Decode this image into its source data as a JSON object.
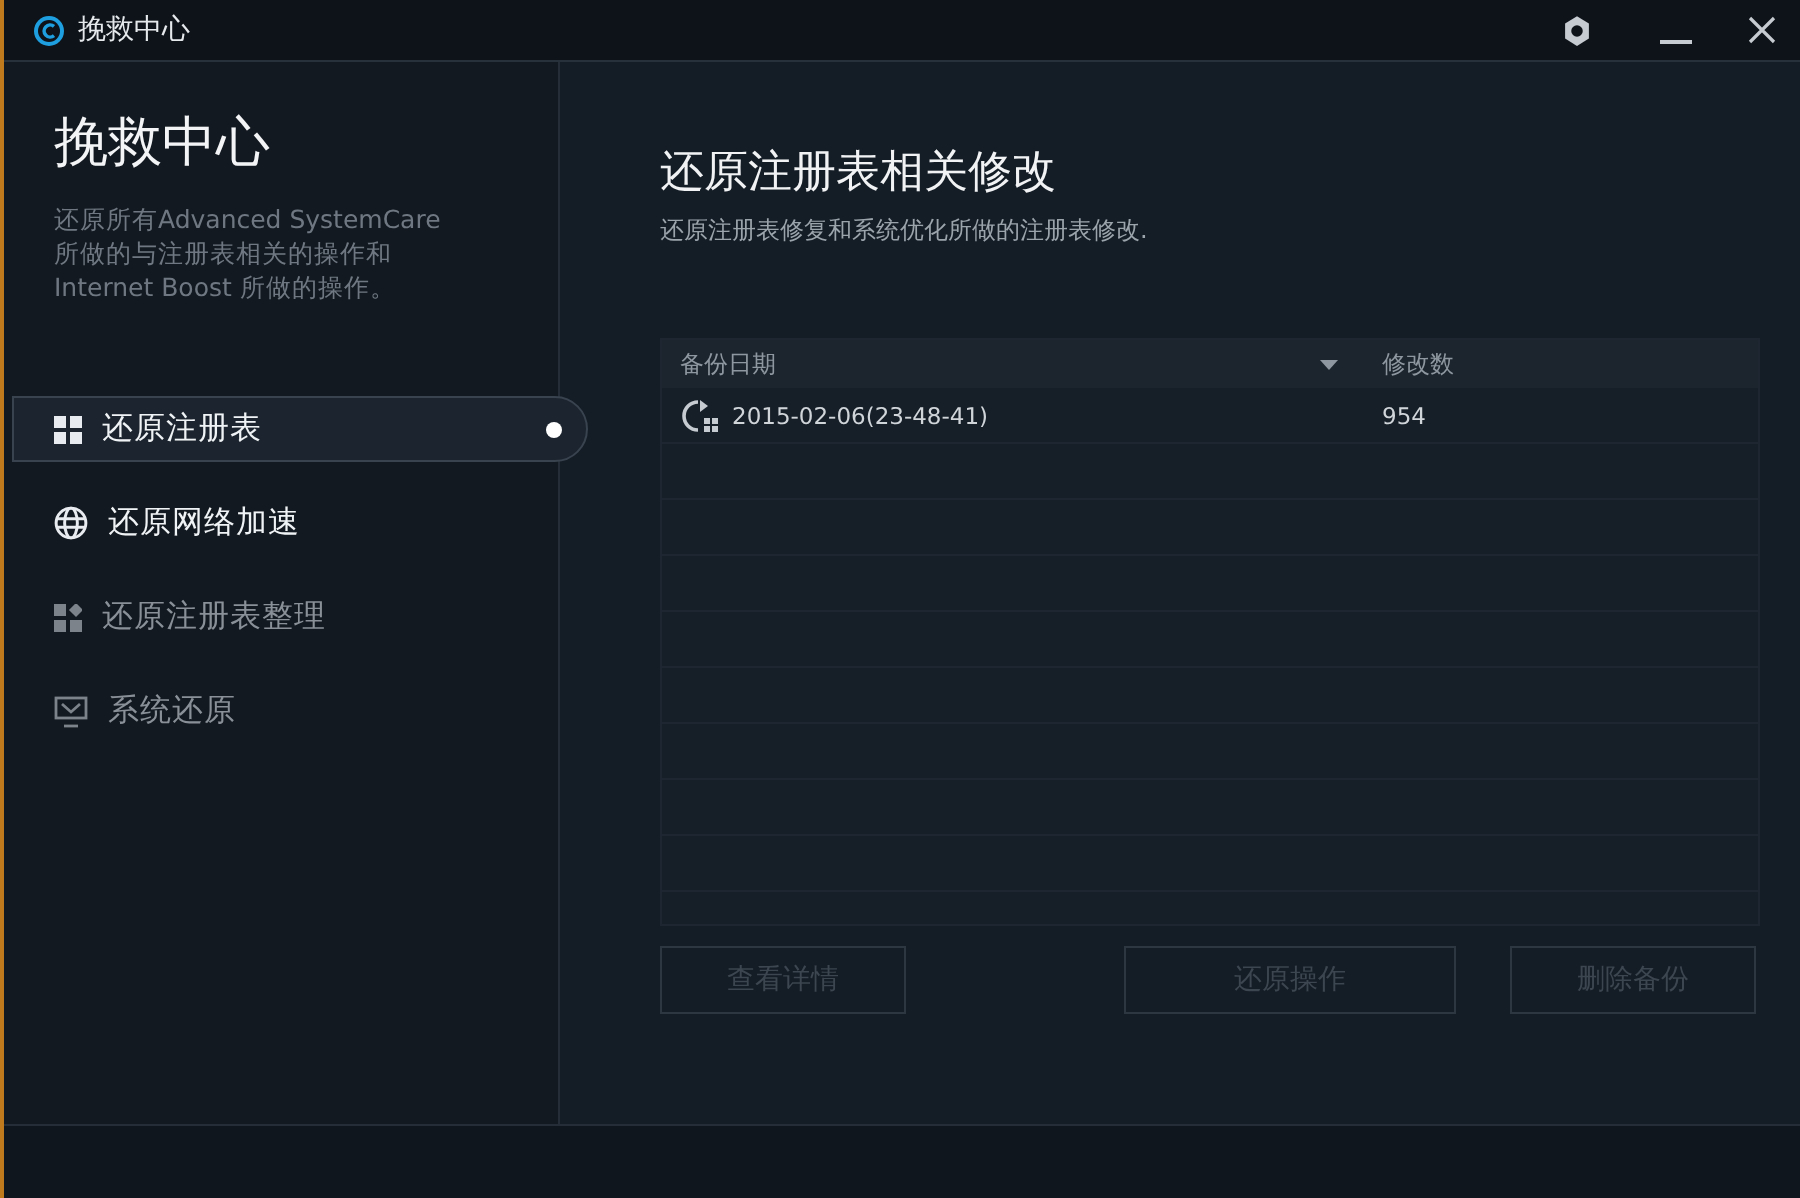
{
  "window": {
    "title": "挽救中心"
  },
  "sidebar": {
    "title": "挽救中心",
    "description": "还原所有Advanced SystemCare 所做的与注册表相关的操作和 Internet Boost 所做的操作。",
    "items": [
      {
        "label": "还原注册表",
        "kind": "tiles",
        "selected": true,
        "disabled": false
      },
      {
        "label": "还原网络加速",
        "kind": "globe",
        "selected": false,
        "disabled": false
      },
      {
        "label": "还原注册表整理",
        "kind": "puzzle",
        "selected": false,
        "disabled": true
      },
      {
        "label": "系统还原",
        "kind": "monitor",
        "selected": false,
        "disabled": true
      }
    ]
  },
  "main": {
    "title": "还原注册表相关修改",
    "subtitle": "还原注册表修复和系统优化所做的注册表修改.",
    "table": {
      "columns": [
        "备份日期",
        "修改数"
      ],
      "rows": [
        {
          "date": "2015-02-06(23-48-41)",
          "count": "954",
          "selected": false
        }
      ]
    },
    "buttons": [
      {
        "label": "查看详情",
        "disabled": true
      },
      {
        "label": "还原操作",
        "disabled": true
      },
      {
        "label": "删除备份",
        "disabled": true
      }
    ]
  }
}
